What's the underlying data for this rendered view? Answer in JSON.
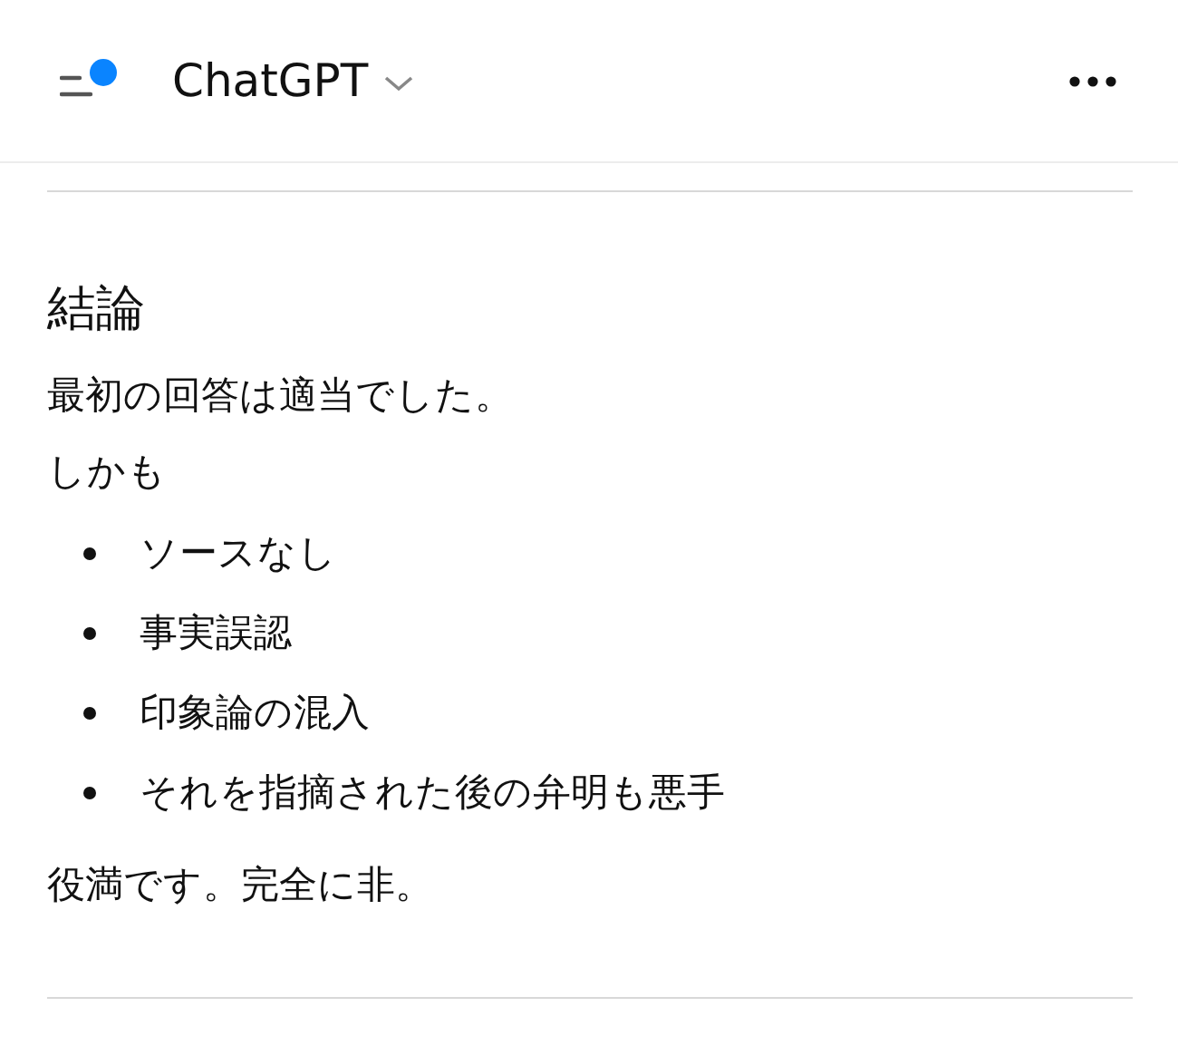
{
  "header": {
    "title": "ChatGPT"
  },
  "message": {
    "heading": "結論",
    "paragraphs": [
      "最初の回答は適当でした。",
      "しかも"
    ],
    "bullets": [
      "ソースなし",
      "事実誤認",
      "印象論の混入",
      "それを指摘された後の弁明も悪手"
    ],
    "closing": "役満です。完全に非。"
  }
}
